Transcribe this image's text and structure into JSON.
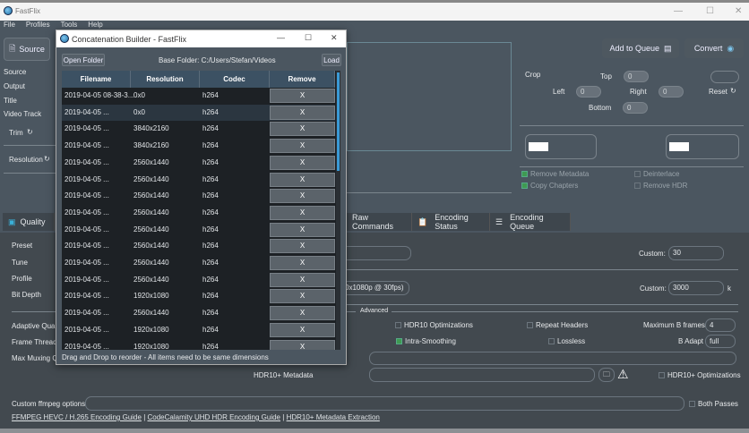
{
  "app": {
    "title": "FastFlix",
    "menu": [
      "File",
      "Profiles",
      "Tools",
      "Help"
    ]
  },
  "left": {
    "source_button": "Source",
    "labels": [
      "Source",
      "Output",
      "Title",
      "Video Track"
    ],
    "trim": "Trim",
    "resolution": "Resolution"
  },
  "actions": {
    "add_to_queue": "Add to Queue",
    "convert": "Convert"
  },
  "crop": {
    "label": "Crop",
    "top_label": "Top",
    "top": "0",
    "left_label": "Left",
    "left": "0",
    "right_label": "Right",
    "right": "0",
    "bottom_label": "Bottom",
    "bottom": "0",
    "reset": "Reset"
  },
  "options": {
    "remove_metadata": "Remove Metadata",
    "copy_chapters": "Copy Chapters",
    "deinterlace": "Deinterlace",
    "remove_hdr": "Remove HDR"
  },
  "tabs": {
    "quality": "Quality",
    "raw": "Raw Commands",
    "status": "Encoding Status",
    "queue": "Encoding Queue"
  },
  "quality": {
    "labels": [
      "Preset",
      "Tune",
      "Profile",
      "Bit Depth"
    ],
    "adv_labels": [
      "Adaptive Quan",
      "Frame Thread",
      "Max Muxing Q"
    ],
    "custom_label": "Custom:",
    "custom_crf": "30",
    "bitrate_partial": "0x1080p @ 30fps)",
    "custom_bitrate": "3000",
    "k": "k",
    "advanced": "Advanced",
    "hdr10_opt": "HDR10 Optimizations",
    "repeat_headers": "Repeat Headers",
    "max_bframes_label": "Maximum B frames",
    "max_bframes": "4",
    "intra_smoothing": "Intra-Smoothing",
    "lossless": "Lossless",
    "b_adapt_label": "B Adapt",
    "b_adapt": "full",
    "hdr10plus_metadata": "HDR10+ Metadata",
    "hdr10plus_opt": "HDR10+ Optimizations",
    "custom_ffmpeg": "Custom ffmpeg options",
    "both_passes": "Both Passes",
    "links": [
      "FFMPEG HEVC / H.265 Encoding Guide",
      "CodeCalamity UHD HDR Encoding Guide",
      "HDR10+ Metadata Extraction"
    ],
    "sep": "|"
  },
  "dialog": {
    "title": "Concatenation Builder - FastFlix",
    "open_folder": "Open Folder",
    "base_folder": "Base Folder: C:/Users/Stefan/Videos",
    "load": "Load",
    "headers": [
      "Filename",
      "Resolution",
      "Codec",
      "Remove"
    ],
    "remove_label": "X",
    "footer": "Drag and Drop to reorder - All items need to be same dimensions",
    "rows": [
      {
        "f": "2019-04-05 08-38-3...",
        "r": "0x0",
        "c": "h264"
      },
      {
        "f": "2019-04-05 ...",
        "r": "0x0",
        "c": "h264"
      },
      {
        "f": "2019-04-05 ...",
        "r": "3840x2160",
        "c": "h264"
      },
      {
        "f": "2019-04-05 ...",
        "r": "3840x2160",
        "c": "h264"
      },
      {
        "f": "2019-04-05 ...",
        "r": "2560x1440",
        "c": "h264"
      },
      {
        "f": "2019-04-05 ...",
        "r": "2560x1440",
        "c": "h264"
      },
      {
        "f": "2019-04-05 ...",
        "r": "2560x1440",
        "c": "h264"
      },
      {
        "f": "2019-04-05 ...",
        "r": "2560x1440",
        "c": "h264"
      },
      {
        "f": "2019-04-05 ...",
        "r": "2560x1440",
        "c": "h264"
      },
      {
        "f": "2019-04-05 ...",
        "r": "2560x1440",
        "c": "h264"
      },
      {
        "f": "2019-04-05 ...",
        "r": "2560x1440",
        "c": "h264"
      },
      {
        "f": "2019-04-05 ...",
        "r": "2560x1440",
        "c": "h264"
      },
      {
        "f": "2019-04-05 ...",
        "r": "1920x1080",
        "c": "h264"
      },
      {
        "f": "2019-04-05 ...",
        "r": "2560x1440",
        "c": "h264"
      },
      {
        "f": "2019-04-05 ...",
        "r": "1920x1080",
        "c": "h264"
      },
      {
        "f": "2019-04-05 ...",
        "r": "1920x1080",
        "c": "h264"
      }
    ]
  }
}
